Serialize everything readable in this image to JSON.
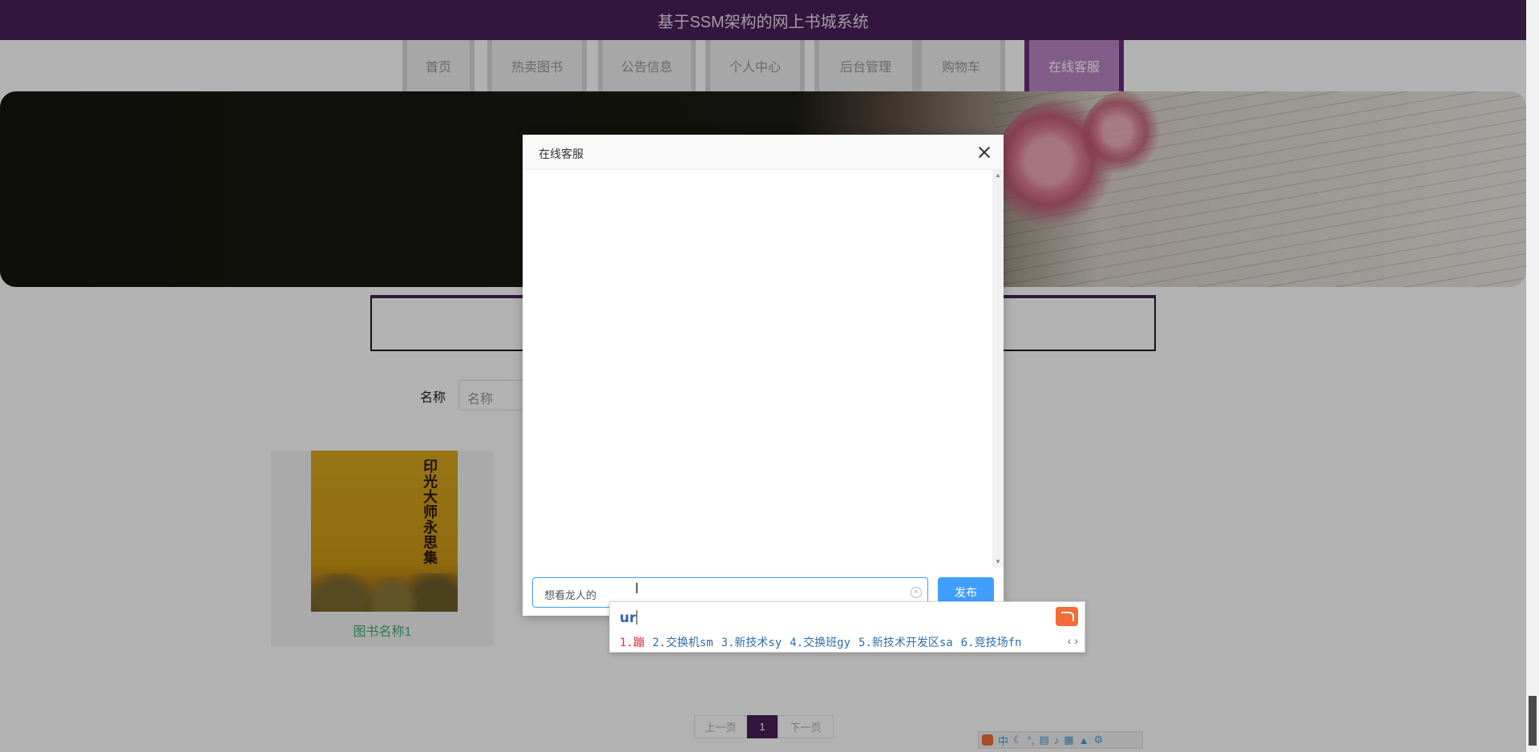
{
  "header": {
    "title": "基于SSM架构的网上书城系统"
  },
  "nav": {
    "items": [
      {
        "label": "首页"
      },
      {
        "label": "热卖图书"
      },
      {
        "label": "公告信息"
      },
      {
        "label": "个人中心"
      },
      {
        "label": "后台管理"
      },
      {
        "label": "购物车"
      },
      {
        "label": "在线客服"
      }
    ],
    "active": "在线客服"
  },
  "search": {
    "label": "名称",
    "placeholder": "名称"
  },
  "books": [
    {
      "name": "图书名称1",
      "cover_title": "印光大师永思集"
    }
  ],
  "pagination": {
    "prev_label": "上一页",
    "current": "1",
    "next_label": "下一页"
  },
  "modal": {
    "title": "在线客服",
    "input_value": "想看龙人的",
    "publish_label": "发布"
  },
  "ime": {
    "typed": "ur",
    "candidates": [
      "1.蹦",
      "2.交换机sm",
      "3.新技术sy",
      "4.交换班gy",
      "5.新技术开发区sa",
      "6.竞技场fn"
    ],
    "toolbar": {
      "mode": "中"
    }
  },
  "colors": {
    "header_bg": "#4a1f58",
    "nav_active": "#bb86c6",
    "primary_button": "#409eff",
    "book_name": "#3fb07a"
  }
}
